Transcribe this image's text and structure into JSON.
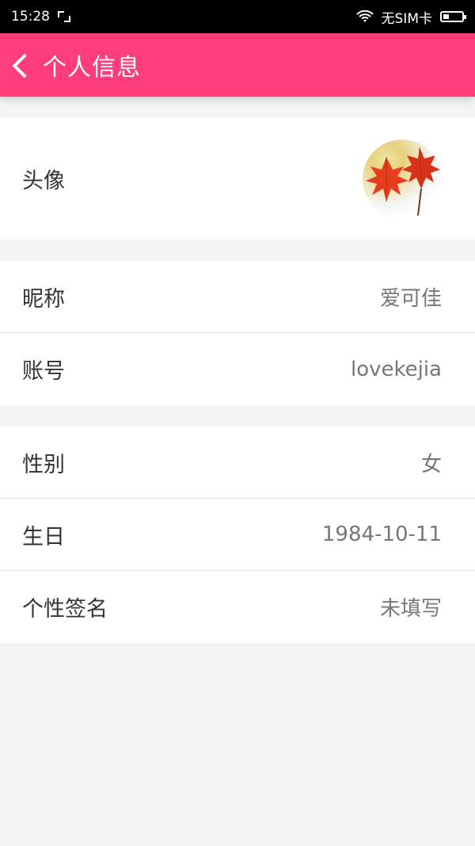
{
  "status_bar": {
    "time": "15:28",
    "carrier": "无SIM卡"
  },
  "app_bar": {
    "title": "个人信息"
  },
  "groups": [
    {
      "rows": [
        {
          "label": "头像",
          "value": ""
        }
      ]
    },
    {
      "rows": [
        {
          "label": "昵称",
          "value": "爱可佳"
        },
        {
          "label": "账号",
          "value": "lovekejia"
        }
      ]
    },
    {
      "rows": [
        {
          "label": "性别",
          "value": "女"
        },
        {
          "label": "生日",
          "value": "1984-10-11"
        },
        {
          "label": "个性签名",
          "value": "未填写"
        }
      ]
    }
  ],
  "colors": {
    "accent": "#ff3d7a",
    "background": "#f4f4f4"
  },
  "icons": {
    "back": "back-icon",
    "wifi": "wifi-icon",
    "battery": "battery-icon",
    "screenshot": "screenshot-icon",
    "avatar": "avatar-image"
  }
}
